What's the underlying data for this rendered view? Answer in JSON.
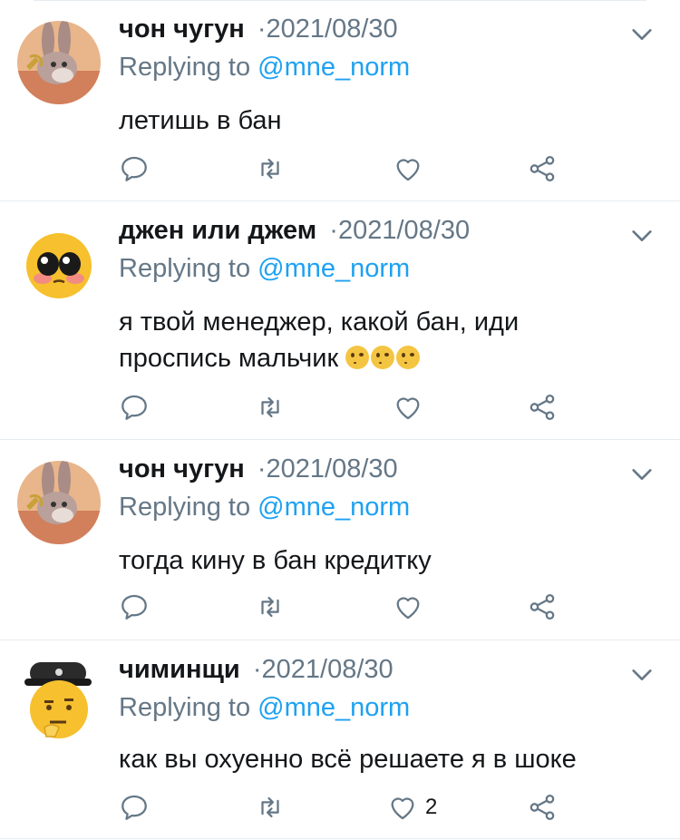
{
  "colors": {
    "accent": "#1da1f2",
    "muted": "#657786",
    "text": "#14171a",
    "divider": "#e6ecf0"
  },
  "tweets": [
    {
      "name": "чон чугун",
      "date": "2021/08/30",
      "replying_prefix": "Replying to",
      "replying_handle": "@mne_norm",
      "text": "летишь в бан",
      "like_count": ""
    },
    {
      "name": "джен или джем",
      "date": "2021/08/30",
      "replying_prefix": "Replying to",
      "replying_handle": "@mne_norm",
      "text_line1": "я твой менеджер, какой бан, иди",
      "text_line2": "проспись мальчик",
      "like_count": ""
    },
    {
      "name": "чон чугун",
      "date": "2021/08/30",
      "replying_prefix": "Replying to",
      "replying_handle": "@mne_norm",
      "text": "тогда кину в бан кредитку",
      "like_count": ""
    },
    {
      "name": "чиминщи",
      "date": "2021/08/30",
      "replying_prefix": "Replying to",
      "replying_handle": "@mne_norm",
      "text": "как вы охуенно всё решаете я в шоке",
      "like_count": "2"
    }
  ],
  "separator": "·"
}
